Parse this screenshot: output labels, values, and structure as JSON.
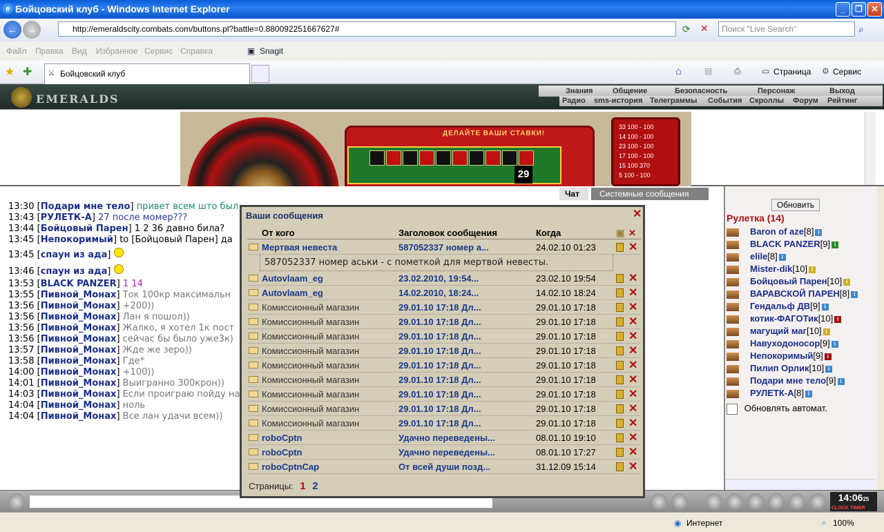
{
  "window": {
    "title": "Бойцовский клуб - Windows Internet Explorer",
    "url": "http://emeraldscity.combats.com/buttons.pl?battle=0.880092251667627#",
    "search_placeholder": "Поиск \"Live Search\"",
    "menu": [
      "Файл",
      "Правка",
      "Вид",
      "Избранное",
      "Сервис",
      "Справка"
    ],
    "snagit": "Snagit",
    "tab_title": "Бойцовский клуб",
    "page_btn": "Страница",
    "tools_btn": "Сервис",
    "status_zone": "Интернет",
    "zoom": "100%"
  },
  "game": {
    "logo": "EMERALDS",
    "top_menu": [
      "Знания",
      "Общение",
      "Безопасность",
      "Персонаж",
      "Выход"
    ],
    "sub_menu": [
      "Радио",
      "sms-история",
      "Телеграммы",
      "События",
      "Скроллы",
      "Форум",
      "Рейтинг"
    ],
    "roulette_banner": "ДЕЛАЙТЕ ВАШИ СТАВКИ!",
    "winning_number": "29",
    "bet_table": [
      "33  100 - 100",
      "14  100 - 100",
      "23  100 - 100",
      "17  100 - 100",
      "15  100  370",
      "5  100 - 100"
    ],
    "chat_tab": "Чат",
    "system_tab": "Системные сообщения",
    "clock": "14:06",
    "clock_sec": "25",
    "clock_label": "CLOCK TIMER"
  },
  "chat": [
    {
      "time": "13:30",
      "nick": "Подари мне тело",
      "msg": "привет всем што был",
      "color": "grn"
    },
    {
      "time": "13:43",
      "nick": "РУЛЕТК-А",
      "msg": "27 после момер???",
      "color": "blu"
    },
    {
      "time": "13:44",
      "nick": "Бойцовый Парен",
      "msg": "1 2 36 давно била?",
      "color": "t"
    },
    {
      "time": "13:45",
      "nick": "Непокоримый",
      "msg": "to [Бойцовый Парен] да",
      "color": "t"
    },
    {
      "time": "13:45",
      "nick": "спаун из ада",
      "msg": "",
      "color": "t",
      "smile": true
    },
    {
      "time": "13:46",
      "nick": "спаун из ада",
      "msg": "",
      "color": "t",
      "smile": true
    },
    {
      "time": "13:53",
      "nick": "BLACK PANZER",
      "msg": "1 14",
      "color": "mag"
    },
    {
      "time": "13:55",
      "nick": "Пивной_Монах",
      "msg": "Ток 100кр максимальн",
      "color": "g"
    },
    {
      "time": "13:56",
      "nick": "Пивной_Монах",
      "msg": "+200))",
      "color": "g"
    },
    {
      "time": "13:56",
      "nick": "Пивной_Монах",
      "msg": "Лан я пошол))",
      "color": "g"
    },
    {
      "time": "13:56",
      "nick": "Пивной_Монах",
      "msg": "Жалко, я хотел 1к пост",
      "color": "g"
    },
    {
      "time": "13:56",
      "nick": "Пивной_Монах",
      "msg": "сейчас бы было уже3к)",
      "color": "g"
    },
    {
      "time": "13:57",
      "nick": "Пивной_Монах",
      "msg": "Жде же зеро))",
      "color": "g"
    },
    {
      "time": "13:58",
      "nick": "Пивной_Монах",
      "msg": "Где*",
      "color": "g"
    },
    {
      "time": "14:00",
      "nick": "Пивной_Монах",
      "msg": "+100))",
      "color": "g"
    },
    {
      "time": "14:01",
      "nick": "Пивной_Монах",
      "msg": "Выигранно 300крон))",
      "color": "g"
    },
    {
      "time": "14:03",
      "nick": "Пивной_Монах",
      "msg": "Если проиграю пойду на",
      "color": "g"
    },
    {
      "time": "14:04",
      "nick": "Пивной_Монах",
      "msg": "ноль",
      "color": "g"
    },
    {
      "time": "14:04",
      "nick": "Пивной_Монах",
      "msg": "Все лан удачи всем))",
      "color": "g"
    }
  ],
  "room": {
    "refresh_label": "Обновить",
    "title": "Рулетка (14)",
    "auto_refresh": "Обновлять автомат.",
    "users": [
      {
        "name": "Baron of aze",
        "level": "[8]",
        "info": "b"
      },
      {
        "name": "BLACK PANZER",
        "level": "[9]",
        "info": "g"
      },
      {
        "name": "elile",
        "level": "[8]",
        "info": "b"
      },
      {
        "name": "Mister-dik",
        "level": "[10]",
        "info": "y"
      },
      {
        "name": "Бойцовый Парен",
        "level": "[10]",
        "info": "y"
      },
      {
        "name": "ВАРАВСКОЙ ПАРЕН",
        "level": "[8]",
        "info": "b"
      },
      {
        "name": "Гендальф ДВ",
        "level": "[9]",
        "info": "b"
      },
      {
        "name": "котик-ФАГОТик",
        "level": "[10]",
        "info": "r"
      },
      {
        "name": "магущий маг",
        "level": "[10]",
        "info": "y"
      },
      {
        "name": "Навуходоносор",
        "level": "[9]",
        "info": "b"
      },
      {
        "name": "Непокоримый",
        "level": "[9]",
        "info": "r"
      },
      {
        "name": "Пилип Орлик",
        "level": "[10]",
        "info": "b"
      },
      {
        "name": "Подари мне тело",
        "level": "[9]",
        "info": "b"
      },
      {
        "name": "РУЛЕТК-А",
        "level": "[8]",
        "info": "b"
      }
    ]
  },
  "messages": {
    "title": "Ваши сообщения",
    "col_from": "От кого",
    "col_subject": "Заголовок сообщения",
    "col_when": "Когда",
    "pages_label": "Страницы:",
    "page_current": "1",
    "page_next": "2",
    "expanded_body": "587052337 номер аськи - с пометкой для мертвой невесты.",
    "rows": [
      {
        "from": "Мертвая невеста",
        "subject": "587052337 номер а...",
        "when": "24.02.10 01:23",
        "bold": true
      },
      {
        "from": "Autovlaam_eg",
        "subject": "23.02.2010, 19:54...",
        "when": "23.02.10 19:54",
        "bold": true
      },
      {
        "from": "Autovlaam_eg",
        "subject": "14.02.2010, 18:24...",
        "when": "14.02.10 18:24",
        "bold": true
      },
      {
        "from": "Комиссионный магазин",
        "subject": "29.01.10 17:18 Дл...",
        "when": "29.01.10 17:18",
        "bold": false
      },
      {
        "from": "Комиссионный магазин",
        "subject": "29.01.10 17:18 Дл...",
        "when": "29.01.10 17:18",
        "bold": false
      },
      {
        "from": "Комиссионный магазин",
        "subject": "29.01.10 17:18 Дл...",
        "when": "29.01.10 17:18",
        "bold": false
      },
      {
        "from": "Комиссионный магазин",
        "subject": "29.01.10 17:18 Дл...",
        "when": "29.01.10 17:18",
        "bold": false
      },
      {
        "from": "Комиссионный магазин",
        "subject": "29.01.10 17:18 Дл...",
        "when": "29.01.10 17:18",
        "bold": false
      },
      {
        "from": "Комиссионный магазин",
        "subject": "29.01.10 17:18 Дл...",
        "when": "29.01.10 17:18",
        "bold": false
      },
      {
        "from": "Комиссионный магазин",
        "subject": "29.01.10 17:18 Дл...",
        "when": "29.01.10 17:18",
        "bold": false
      },
      {
        "from": "Комиссионный магазин",
        "subject": "29.01.10 17:18 Дл...",
        "when": "29.01.10 17:18",
        "bold": false
      },
      {
        "from": "Комиссионный магазин",
        "subject": "29.01.10 17:18 Дл...",
        "when": "29.01.10 17:18",
        "bold": false
      },
      {
        "from": "roboCptn",
        "subject": "Удачно переведены...",
        "when": "08.01.10 19:10",
        "bold": true
      },
      {
        "from": "roboCptn",
        "subject": "Удачно переведены...",
        "when": "08.01.10 17:27",
        "bold": true
      },
      {
        "from": "roboCptnCap",
        "subject": "От всей души позд...",
        "when": "31.12.09 15:14",
        "bold": true
      }
    ]
  }
}
